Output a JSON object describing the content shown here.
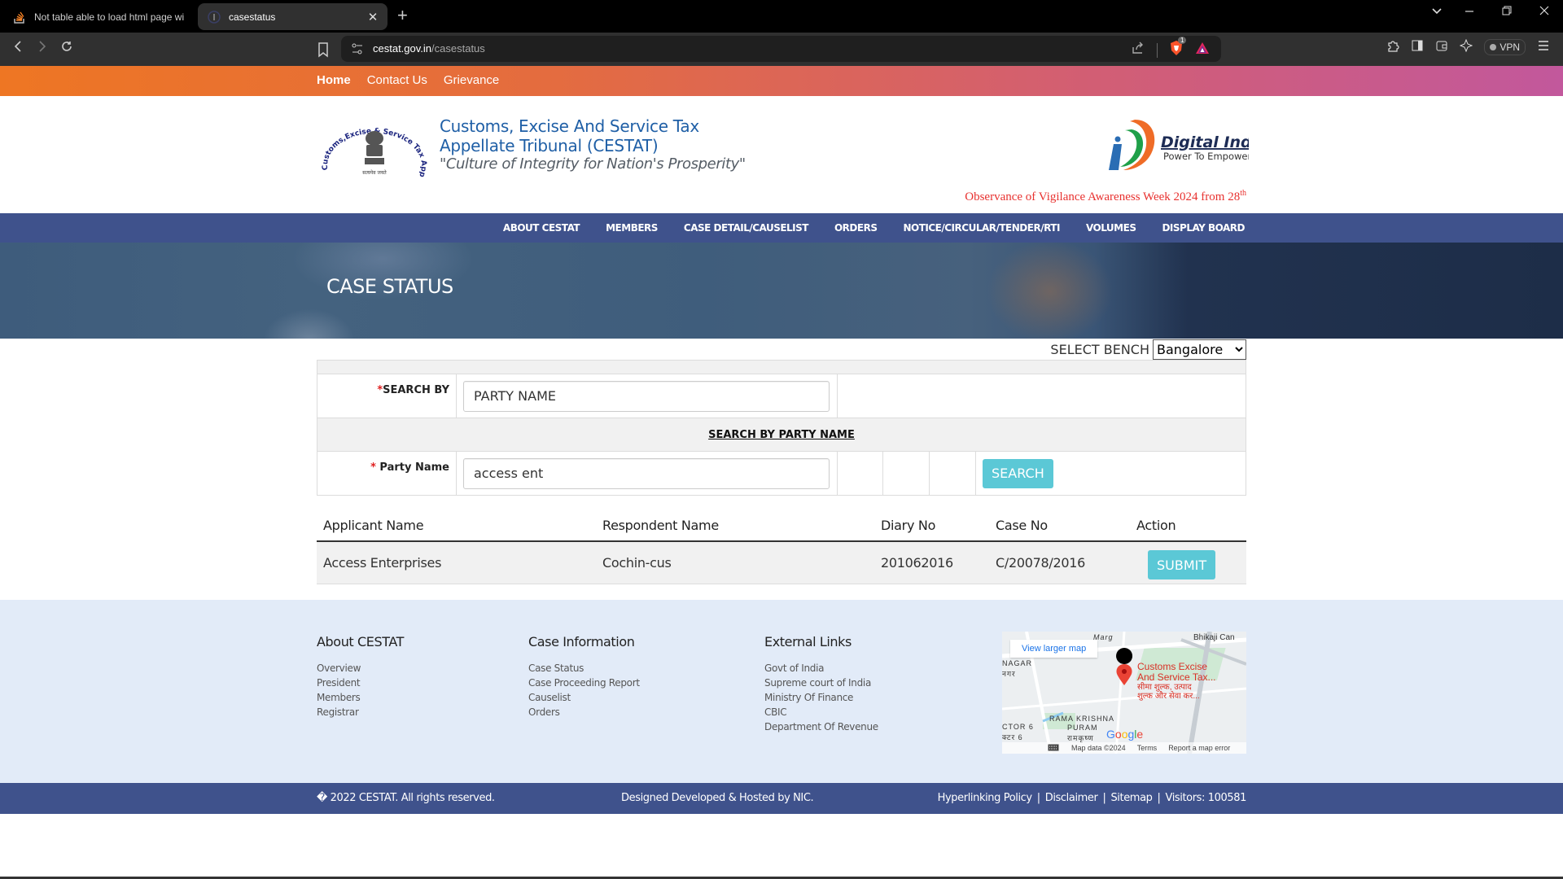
{
  "browser": {
    "tabs": [
      {
        "title": "Not table able to load html page wi",
        "icon": "stackoverflow-icon",
        "active": false
      },
      {
        "title": "casestatus",
        "icon": "site-favicon",
        "active": true
      }
    ],
    "new_tab_label": "+",
    "close_tab_label": "✕",
    "url_host": "cestat.gov.in",
    "url_path": "/casestatus",
    "brave_badge_count": "1",
    "vpn_label": "VPN",
    "window_controls": {
      "dropdown": "⌄",
      "minimize": "—",
      "restore": "❐",
      "close": "✕"
    }
  },
  "topnav": {
    "items": [
      "Home",
      "Contact Us",
      "Grievance"
    ]
  },
  "header": {
    "title_line1": "Customs, Excise And Service Tax",
    "title_line2": "Appellate Tribunal (CESTAT)",
    "motto": "\"Culture of Integrity for Nation's Prosperity\"",
    "emblem_ring_text": "Customs,Excise & Service Tax Appellate Tribunal",
    "emblem_caption": "सत्यमेव जयते",
    "digital_india_title": "Digital India",
    "digital_india_tagline": "Power To Empower",
    "vigilance_text": "Observance of Vigilance Awareness Week 2024 from 28",
    "vigilance_sup": "th"
  },
  "mainmenu": {
    "items": [
      "ABOUT CESTAT",
      "MEMBERS",
      "CASE DETAIL/CAUSELIST",
      "ORDERS",
      "NOTICE/CIRCULAR/TENDER/RTI",
      "VOLUMES",
      "DISPLAY BOARD"
    ]
  },
  "banner": {
    "title": "CASE STATUS"
  },
  "form": {
    "bench_label": "SELECT BENCH",
    "bench_selected": "Bangalore",
    "required_mark": "*",
    "search_by_label": "SEARCH BY",
    "search_by_value": "PARTY NAME",
    "section_title": "SEARCH BY PARTY NAME",
    "party_name_label": " Party Name",
    "party_name_value": "access ent",
    "search_button": "SEARCH"
  },
  "results": {
    "columns": [
      "Applicant Name",
      "Respondent Name",
      "Diary No",
      "Case No",
      "Action"
    ],
    "rows": [
      {
        "applicant": "Access Enterprises",
        "respondent": "Cochin-cus",
        "diary_no": "201062016",
        "case_no": "C/20078/2016",
        "action": "SUBMIT"
      }
    ]
  },
  "footer": {
    "about": {
      "heading": "About CESTAT",
      "links": [
        "Overview",
        "President",
        "Members",
        "Registrar"
      ]
    },
    "case_info": {
      "heading": "Case Information",
      "links": [
        "Case Status",
        "Case Proceeding Report",
        "Causelist",
        "Orders"
      ]
    },
    "external": {
      "heading": "External Links",
      "links": [
        "Govt of India",
        "Supreme court of India",
        "Ministry Of Finance",
        "CBIC",
        "Department Of Revenue"
      ]
    },
    "map": {
      "view_larger": "View larger map",
      "place_name_1": "Customs Excise",
      "place_name_2": "And Service Tax...",
      "place_hindi_1": "सीमा शुल्क, उत्पाद",
      "place_hindi_2": "शुल्क और सेवा कर...",
      "labels": [
        "Bhikaji Can",
        "NAGAR",
        "नगर",
        "RAMA KRISHNA",
        "PURAM",
        "रामकृष्ण",
        "CTOR 6",
        "क्टर 6",
        "Marg"
      ],
      "attribution": [
        "Map data ©2024",
        "Terms",
        "Report a map error"
      ]
    },
    "copyright": "� 2022 CESTAT. All rights reserved.",
    "designed_by": "Designed Developed & Hosted by NIC.",
    "bottom_links": [
      "Hyperlinking Policy",
      "Disclaimer",
      "Sitemap"
    ],
    "visitors": "Visitors: 100581"
  }
}
